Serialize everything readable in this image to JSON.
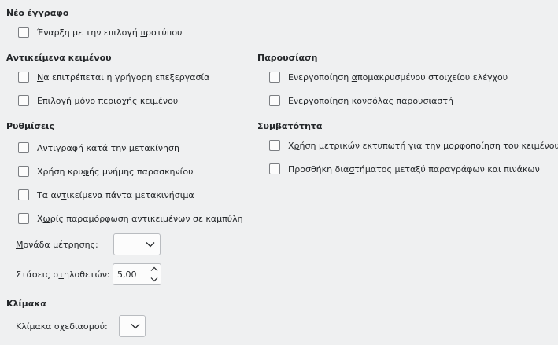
{
  "new_document": {
    "heading": "Νέο έγγραφο",
    "start_with_template": {
      "pre": "Έναρξη με την επιλογή ",
      "mn": "π",
      "post": "ροτύπου",
      "checked": false
    }
  },
  "text_objects": {
    "heading": "Αντικείμενα κειμένου",
    "allow_quick_edit": {
      "pre": "",
      "mn": "Ν",
      "post": "α επιτρέπεται η γρήγορη επεξεργασία",
      "checked": false
    },
    "select_text_area_only": {
      "pre": "",
      "mn": "Ε",
      "post": "πιλογή μόνο περιοχής κειμένου",
      "checked": false
    }
  },
  "presentation": {
    "heading": "Παρουσίαση",
    "enable_remote": {
      "pre": "Ενεργοποίηση ",
      "mn": "α",
      "post": "πομακρυσμένου στοιχείου ελέγχου",
      "checked": false
    },
    "enable_presenter_console": {
      "pre": "Ενεργοποίηση ",
      "mn": "κ",
      "post": "ονσόλας παρουσιαστή",
      "checked": false
    }
  },
  "settings": {
    "heading": "Ρυθμίσεις",
    "copy_when_moving": {
      "pre": "Αντιγρα",
      "mn": "φ",
      "post": "ή κατά την μετακίνηση",
      "checked": false
    },
    "background_cache": {
      "pre": "Χρήση κρυ",
      "mn": "φ",
      "post": "ής μνήμης παρασκηνίου",
      "checked": false
    },
    "objects_always_moveable": {
      "pre": "Τα αν",
      "mn": "τ",
      "post": "ικείμενα πάντα μετακινήσιμα",
      "checked": false
    },
    "no_distortion": {
      "pre": "Χ",
      "mn": "ω",
      "post": "ρίς παραμόρφωση αντικειμένων σε καμπύλη",
      "checked": false
    },
    "unit_label": {
      "pre": "",
      "mn": "Μ",
      "post": "ονάδα μέτρησης:"
    },
    "unit_value": "",
    "tab_stops_label": {
      "pre": "Στάσεις σ",
      "mn": "τ",
      "post": "ηλοθετών:"
    },
    "tab_stops_value": "5,00"
  },
  "compatibility": {
    "heading": "Συμβατότητα",
    "printer_metrics": {
      "pre": "Χ",
      "mn": "ρ",
      "post": "ήση μετρικών εκτυπωτή για την μορφοποίηση του κειμένου",
      "checked": false
    },
    "add_spacing": {
      "pre": "Προσθήκη δια",
      "mn": "σ",
      "post": "τήματος μεταξύ παραγράφων και πινάκων",
      "checked": false
    }
  },
  "scale": {
    "heading": "Κλίμακα",
    "drawing_scale_label": {
      "pre": "Κλίμακα σ",
      "mn": "χ",
      "post": "εδιασμού:"
    },
    "drawing_scale_value": ""
  },
  "icons": {
    "dropdown": "chevron-down-icon",
    "spin_up": "chevron-up-icon",
    "spin_down": "chevron-down-icon"
  }
}
